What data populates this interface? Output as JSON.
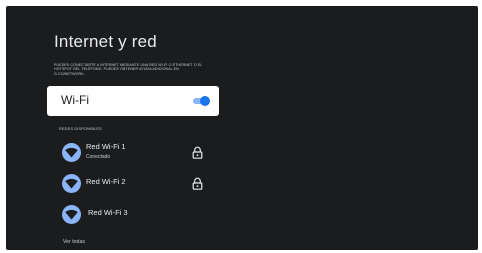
{
  "page": {
    "title": "Internet y red",
    "description": "Puedes conectarte a internet mediante una red Wi-Fi o ethernet o el hotspot del teléfono. Puedes obtener ayuda adicional en g.co/network."
  },
  "wifi": {
    "label": "Wi-Fi",
    "enabled": true
  },
  "networks_section": {
    "label": "Redes disponibles"
  },
  "networks": [
    {
      "name": "Red Wi-Fi 1",
      "status": "Conectado",
      "icon": "wifi-icon",
      "secured": true
    },
    {
      "name": "Red Wi-Fi 2",
      "status": "",
      "icon": "wifi-icon",
      "secured": true
    },
    {
      "name": "Red Wi-Fi 3",
      "status": "",
      "icon": "wifi-icon",
      "secured": false
    }
  ],
  "see_all": {
    "label": "Ver todas"
  },
  "colors": {
    "background": "#1b1c1e",
    "accent": "#1a73e8",
    "icon_bg": "#8ab4f8",
    "card": "#ffffff"
  }
}
